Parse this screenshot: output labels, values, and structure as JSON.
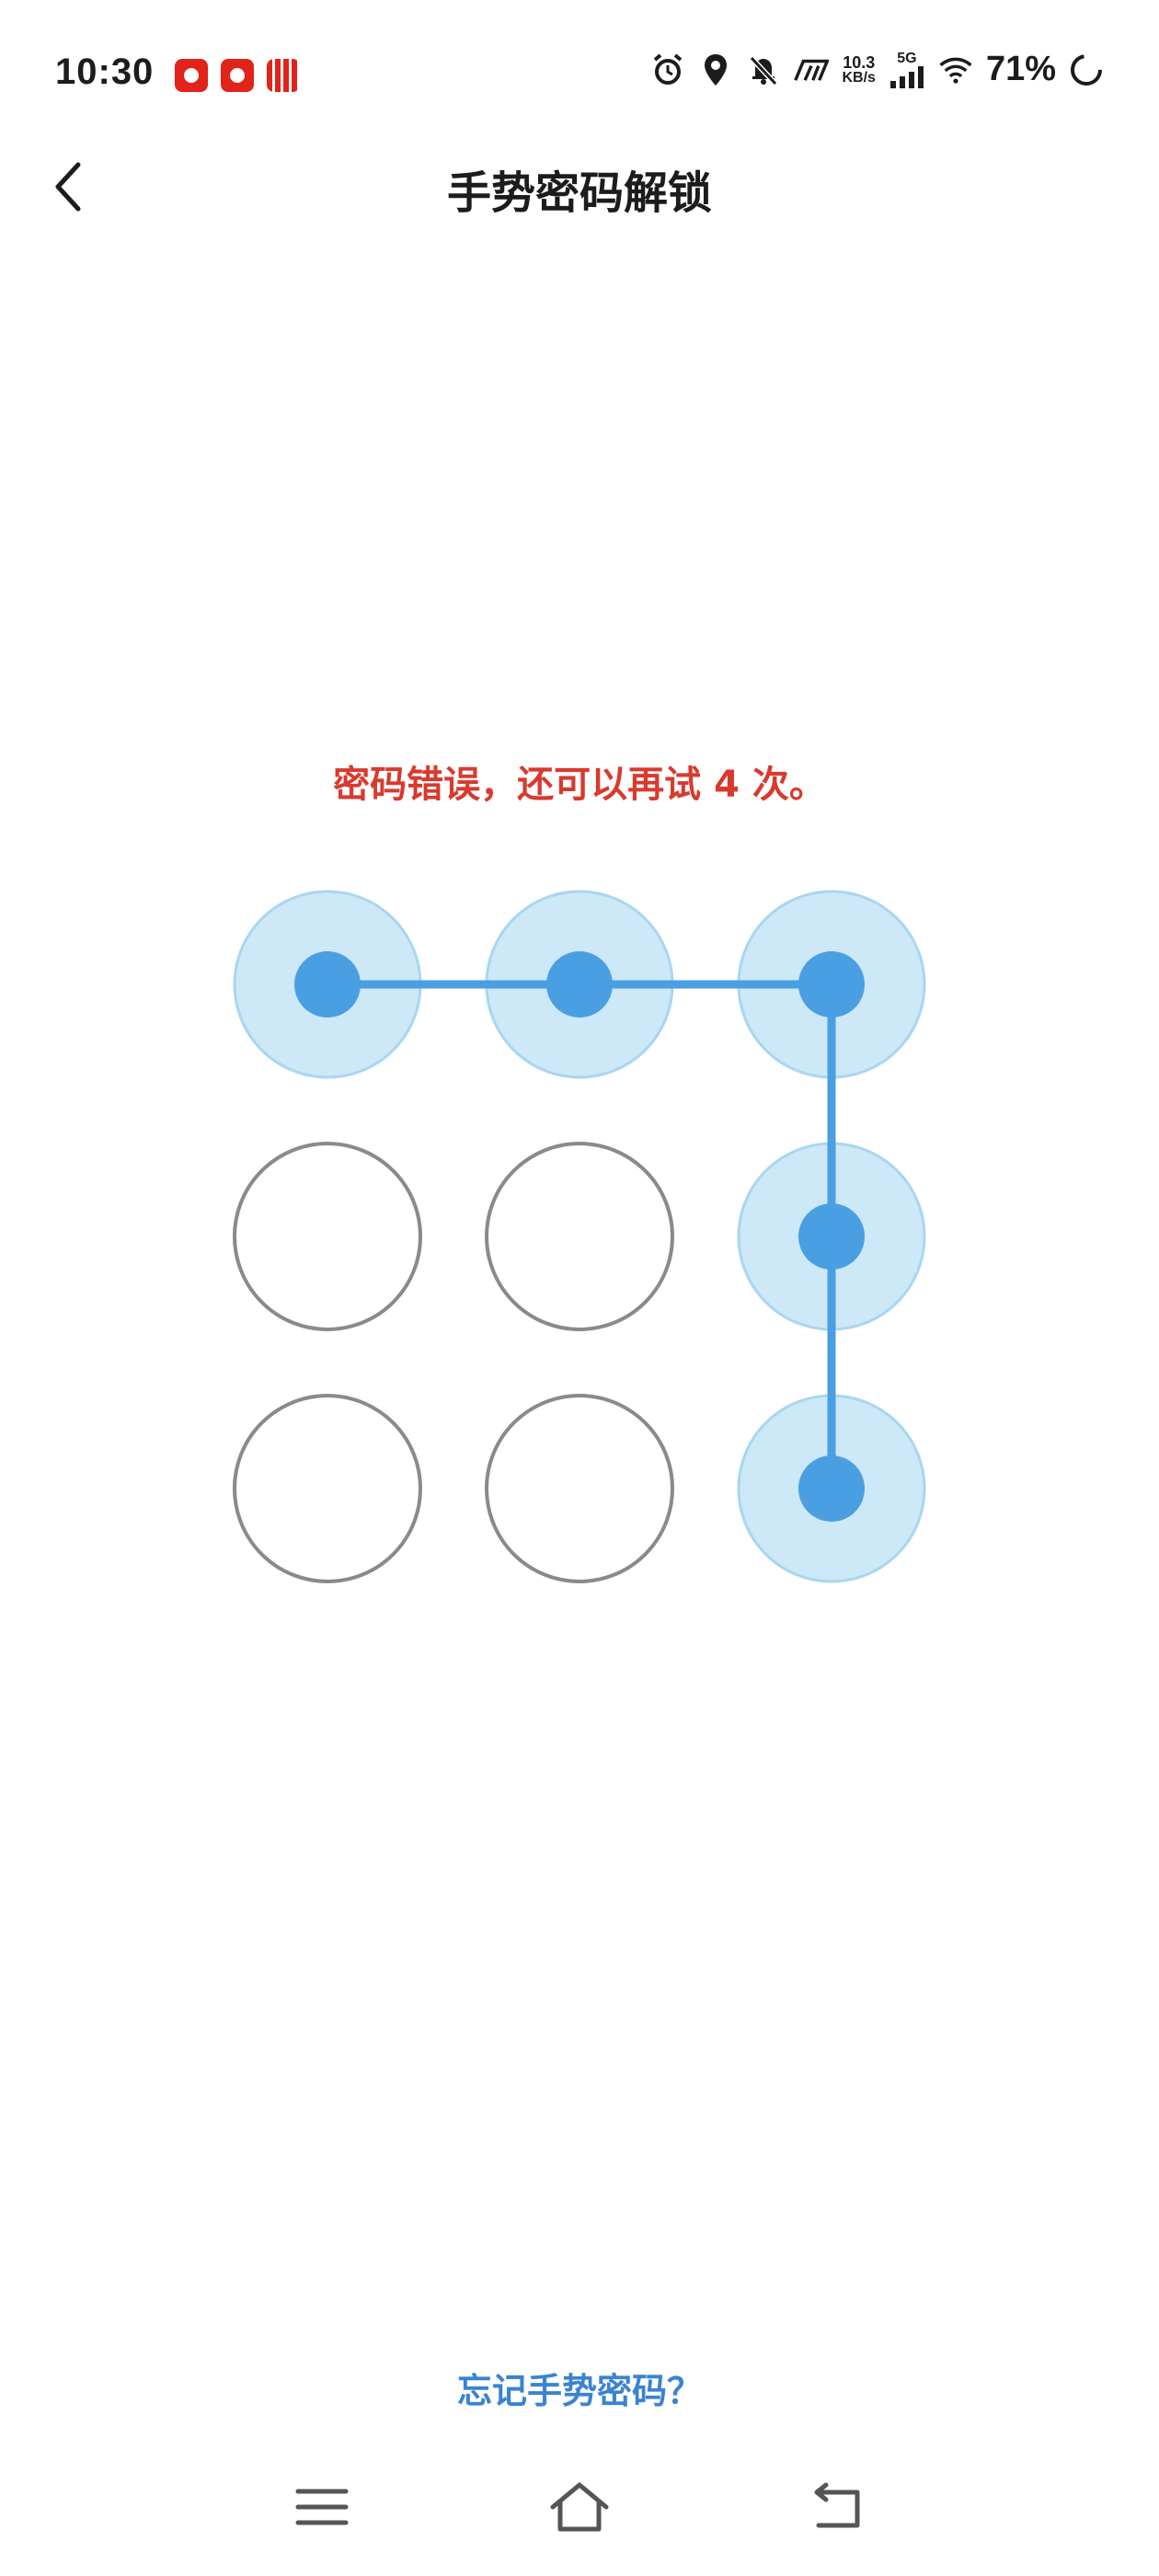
{
  "status_bar": {
    "time": "10:30",
    "net_speed": "10.3",
    "net_unit": "KB/s",
    "network_gen": "5G",
    "battery": "71%"
  },
  "header": {
    "title": "手势密码解锁"
  },
  "message": {
    "error": "密码错误，还可以再试 4 次。"
  },
  "pattern": {
    "selected": [
      1,
      2,
      3,
      6,
      9
    ],
    "colors": {
      "active_fill": "#cde8f6",
      "active_ring": "#a9d6f1",
      "dot": "#4a9fe2",
      "line": "#4a9fe2",
      "idle_ring": "#8a8a8a"
    }
  },
  "footer": {
    "forgot_link": "忘记手势密码？"
  },
  "colors": {
    "error": "#d83a2e",
    "link": "#3a83d1"
  }
}
